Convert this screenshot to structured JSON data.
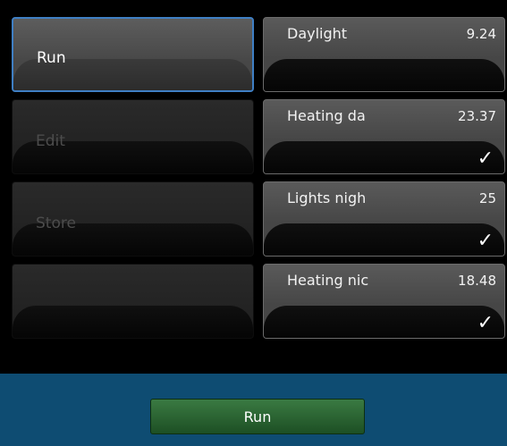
{
  "scenes": [
    {
      "label": "Run",
      "active": true
    },
    {
      "label": "Edit",
      "active": false
    },
    {
      "label": "Store",
      "active": false
    },
    {
      "label": "",
      "active": false
    }
  ],
  "slots": [
    {
      "name": "Daylight",
      "value": "9.24",
      "check": ""
    },
    {
      "name": "Heating da",
      "value": "23.37",
      "check": "✓"
    },
    {
      "name": "Lights nigh",
      "value": "25",
      "check": "✓"
    },
    {
      "name": "Heating nic",
      "value": "18.48",
      "check": "✓"
    }
  ],
  "footer": {
    "run_label": "Run"
  }
}
